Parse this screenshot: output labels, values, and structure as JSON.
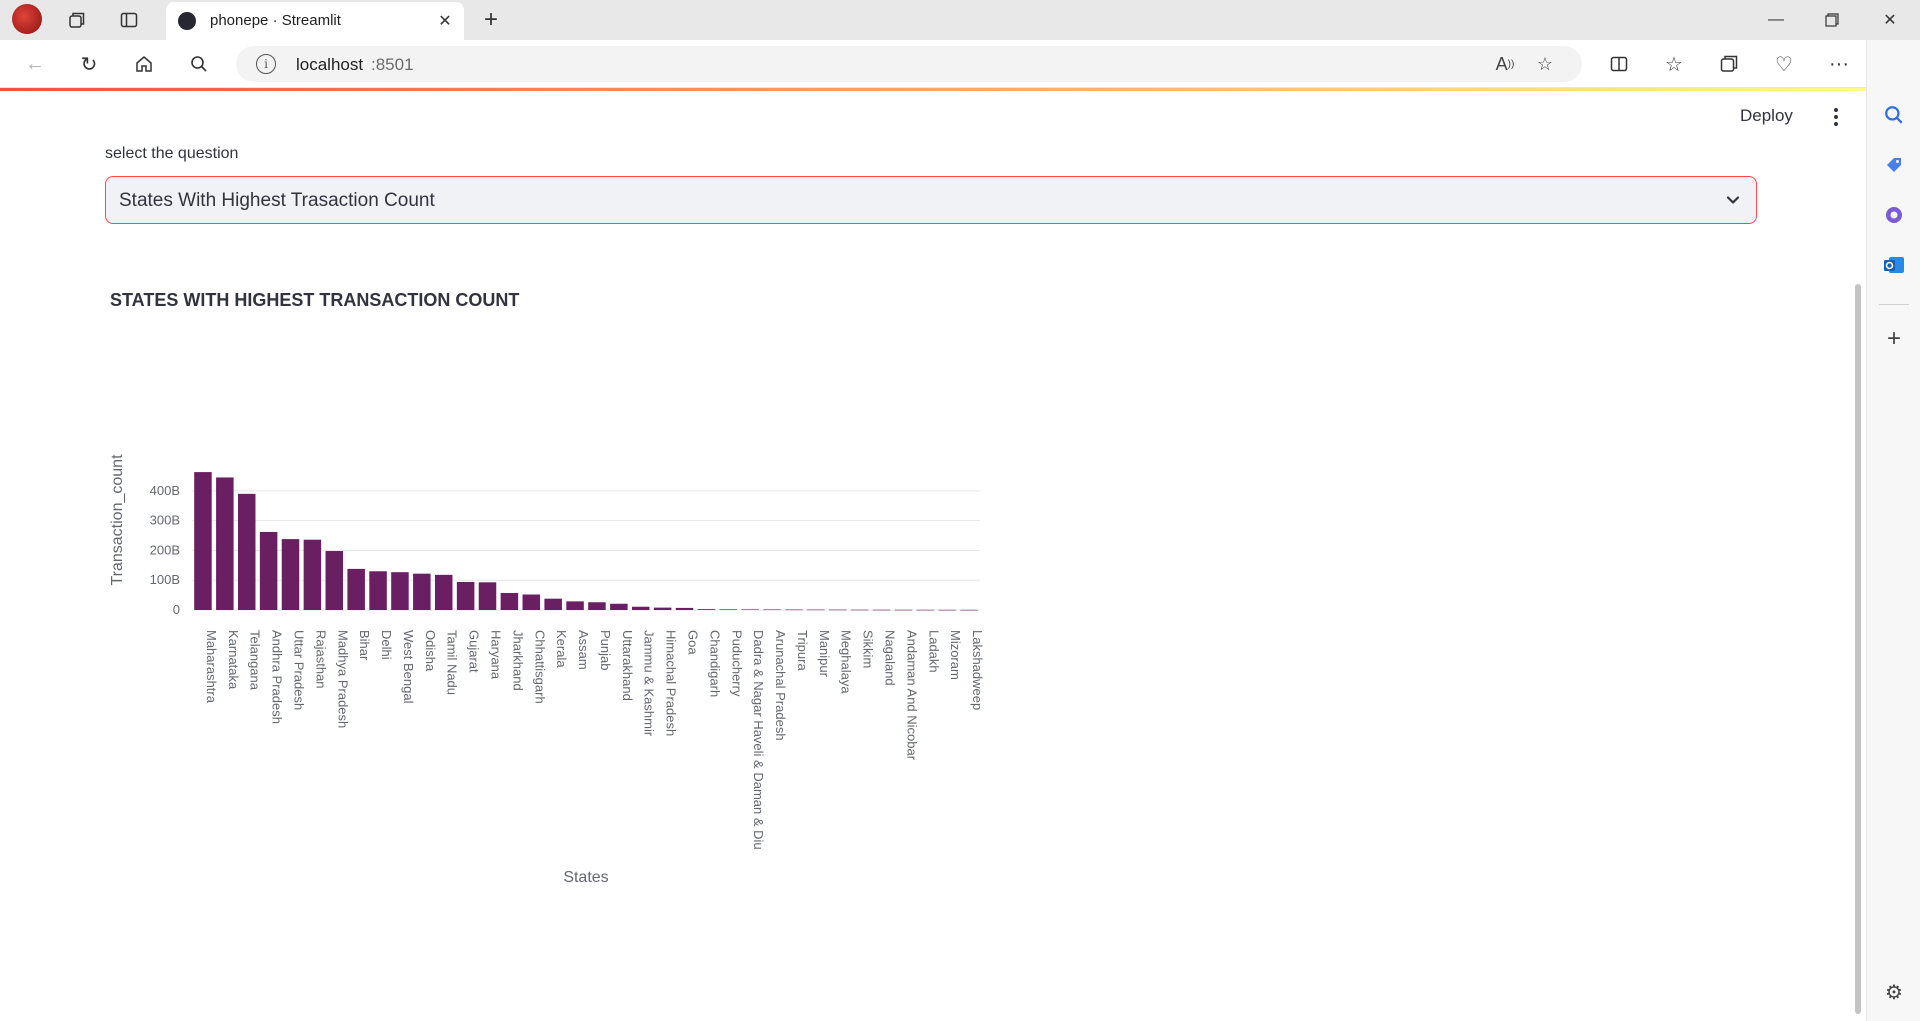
{
  "browser": {
    "tab_title": "phonepe · Streamlit",
    "address_host": "localhost",
    "address_port": ":8501"
  },
  "app": {
    "deploy_label": "Deploy",
    "select_label": "select the question",
    "selected_question": "States With Highest Trasaction Count",
    "chart_title": "STATES WITH HIGHEST TRANSACTION COUNT"
  },
  "colors": {
    "bar": "#6b1f63",
    "accent": "#ff4b4b",
    "grid": "#e6e6e6"
  },
  "chart_data": {
    "type": "bar",
    "title": "STATES WITH HIGHEST TRANSACTION COUNT",
    "xlabel": "States",
    "ylabel": "Transaction_count",
    "ylim": [
      0,
      470
    ],
    "y_ticks": [
      0,
      100,
      200,
      300,
      400
    ],
    "y_tick_labels": [
      "0",
      "100B",
      "200B",
      "300B",
      "400B"
    ],
    "grid": true,
    "categories": [
      "Maharashtra",
      "Karnataka",
      "Telangana",
      "Andhra Pradesh",
      "Uttar Pradesh",
      "Rajasthan",
      "Madhya Pradesh",
      "Bihar",
      "Delhi",
      "West Bengal",
      "Odisha",
      "Tamil Nadu",
      "Gujarat",
      "Haryana",
      "Jharkhand",
      "Chhattisgarh",
      "Kerala",
      "Assam",
      "Punjab",
      "Uttarakhand",
      "Jammu & Kashmir",
      "Himachal Pradesh",
      "Goa",
      "Chandigarh",
      "Puducherry",
      "Dadra & Nagar Haveli & Daman & Diu",
      "Arunachal Pradesh",
      "Tripura",
      "Manipur",
      "Meghalaya",
      "Sikkim",
      "Nagaland",
      "Andaman And Nicobar",
      "Ladakh",
      "Mizoram",
      "Lakshadweep"
    ],
    "values": [
      463,
      445,
      390,
      262,
      238,
      236,
      198,
      138,
      130,
      127,
      122,
      118,
      94,
      93,
      57,
      52,
      38,
      29,
      26,
      21,
      11,
      8,
      7,
      2.8,
      2.2,
      2.0,
      1.8,
      1.6,
      1.4,
      1.2,
      1.0,
      0.9,
      0.8,
      0.7,
      0.6,
      0.5
    ]
  }
}
